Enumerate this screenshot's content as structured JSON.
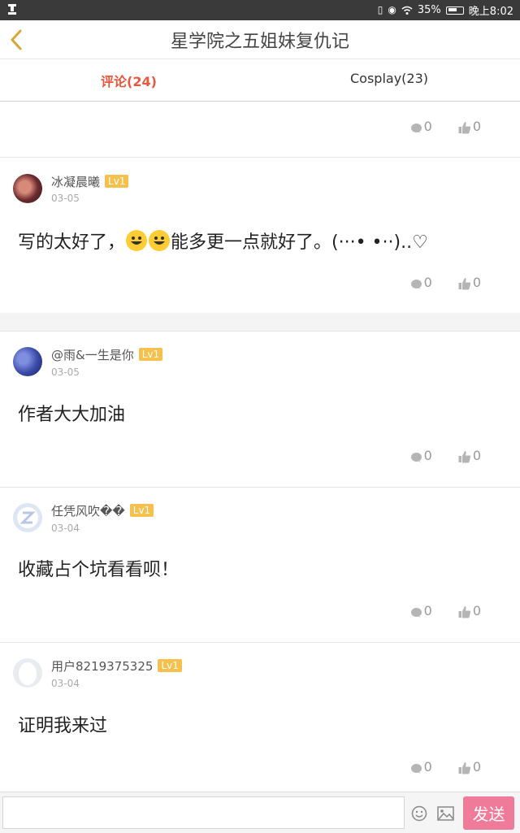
{
  "status_bar": {
    "battery": "35%",
    "time": "晚上8:02"
  },
  "header": {
    "title": "星学院之五姐妹复仇记"
  },
  "tabs": [
    {
      "label": "评论(24)",
      "active": true
    },
    {
      "label": "Cosplay(23)",
      "active": false
    }
  ],
  "first_stats": {
    "comments": "0",
    "likes": "0"
  },
  "comments": [
    {
      "user": "冰凝晨曦",
      "level": "Lv1",
      "date": "03-05",
      "text_before": "写的太好了，",
      "text_after": "能多更一点就好了。(···•  •··)..♡",
      "comments": "0",
      "likes": "0"
    },
    {
      "user": "@雨&一生是你",
      "level": "Lv1",
      "date": "03-05",
      "text": "作者大大加油",
      "comments": "0",
      "likes": "0"
    },
    {
      "user": "任凭风吹��",
      "level": "Lv1",
      "date": "03-04",
      "text": "收藏占个坑看看呗！",
      "comments": "0",
      "likes": "0"
    },
    {
      "user": "用户8219375325",
      "level": "Lv1",
      "date": "03-04",
      "text": "证明我来过",
      "comments": "0",
      "likes": "0"
    }
  ],
  "bottom_bar": {
    "input_value": "",
    "input_placeholder": "",
    "send_label": "发送"
  },
  "colors": {
    "accent": "#e8573e",
    "level_badge": "#f5c04c",
    "send_button": "#f07a99"
  }
}
